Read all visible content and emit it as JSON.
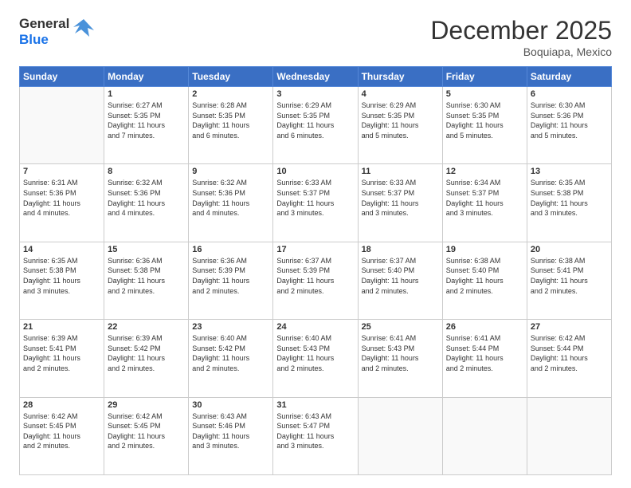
{
  "logo": {
    "line1": "General",
    "line2": "Blue"
  },
  "header": {
    "month": "December 2025",
    "location": "Boquiapa, Mexico"
  },
  "weekdays": [
    "Sunday",
    "Monday",
    "Tuesday",
    "Wednesday",
    "Thursday",
    "Friday",
    "Saturday"
  ],
  "weeks": [
    [
      {
        "day": "",
        "info": ""
      },
      {
        "day": "1",
        "info": "Sunrise: 6:27 AM\nSunset: 5:35 PM\nDaylight: 11 hours\nand 7 minutes."
      },
      {
        "day": "2",
        "info": "Sunrise: 6:28 AM\nSunset: 5:35 PM\nDaylight: 11 hours\nand 6 minutes."
      },
      {
        "day": "3",
        "info": "Sunrise: 6:29 AM\nSunset: 5:35 PM\nDaylight: 11 hours\nand 6 minutes."
      },
      {
        "day": "4",
        "info": "Sunrise: 6:29 AM\nSunset: 5:35 PM\nDaylight: 11 hours\nand 5 minutes."
      },
      {
        "day": "5",
        "info": "Sunrise: 6:30 AM\nSunset: 5:35 PM\nDaylight: 11 hours\nand 5 minutes."
      },
      {
        "day": "6",
        "info": "Sunrise: 6:30 AM\nSunset: 5:36 PM\nDaylight: 11 hours\nand 5 minutes."
      }
    ],
    [
      {
        "day": "7",
        "info": "Sunrise: 6:31 AM\nSunset: 5:36 PM\nDaylight: 11 hours\nand 4 minutes."
      },
      {
        "day": "8",
        "info": "Sunrise: 6:32 AM\nSunset: 5:36 PM\nDaylight: 11 hours\nand 4 minutes."
      },
      {
        "day": "9",
        "info": "Sunrise: 6:32 AM\nSunset: 5:36 PM\nDaylight: 11 hours\nand 4 minutes."
      },
      {
        "day": "10",
        "info": "Sunrise: 6:33 AM\nSunset: 5:37 PM\nDaylight: 11 hours\nand 3 minutes."
      },
      {
        "day": "11",
        "info": "Sunrise: 6:33 AM\nSunset: 5:37 PM\nDaylight: 11 hours\nand 3 minutes."
      },
      {
        "day": "12",
        "info": "Sunrise: 6:34 AM\nSunset: 5:37 PM\nDaylight: 11 hours\nand 3 minutes."
      },
      {
        "day": "13",
        "info": "Sunrise: 6:35 AM\nSunset: 5:38 PM\nDaylight: 11 hours\nand 3 minutes."
      }
    ],
    [
      {
        "day": "14",
        "info": "Sunrise: 6:35 AM\nSunset: 5:38 PM\nDaylight: 11 hours\nand 3 minutes."
      },
      {
        "day": "15",
        "info": "Sunrise: 6:36 AM\nSunset: 5:38 PM\nDaylight: 11 hours\nand 2 minutes."
      },
      {
        "day": "16",
        "info": "Sunrise: 6:36 AM\nSunset: 5:39 PM\nDaylight: 11 hours\nand 2 minutes."
      },
      {
        "day": "17",
        "info": "Sunrise: 6:37 AM\nSunset: 5:39 PM\nDaylight: 11 hours\nand 2 minutes."
      },
      {
        "day": "18",
        "info": "Sunrise: 6:37 AM\nSunset: 5:40 PM\nDaylight: 11 hours\nand 2 minutes."
      },
      {
        "day": "19",
        "info": "Sunrise: 6:38 AM\nSunset: 5:40 PM\nDaylight: 11 hours\nand 2 minutes."
      },
      {
        "day": "20",
        "info": "Sunrise: 6:38 AM\nSunset: 5:41 PM\nDaylight: 11 hours\nand 2 minutes."
      }
    ],
    [
      {
        "day": "21",
        "info": "Sunrise: 6:39 AM\nSunset: 5:41 PM\nDaylight: 11 hours\nand 2 minutes."
      },
      {
        "day": "22",
        "info": "Sunrise: 6:39 AM\nSunset: 5:42 PM\nDaylight: 11 hours\nand 2 minutes."
      },
      {
        "day": "23",
        "info": "Sunrise: 6:40 AM\nSunset: 5:42 PM\nDaylight: 11 hours\nand 2 minutes."
      },
      {
        "day": "24",
        "info": "Sunrise: 6:40 AM\nSunset: 5:43 PM\nDaylight: 11 hours\nand 2 minutes."
      },
      {
        "day": "25",
        "info": "Sunrise: 6:41 AM\nSunset: 5:43 PM\nDaylight: 11 hours\nand 2 minutes."
      },
      {
        "day": "26",
        "info": "Sunrise: 6:41 AM\nSunset: 5:44 PM\nDaylight: 11 hours\nand 2 minutes."
      },
      {
        "day": "27",
        "info": "Sunrise: 6:42 AM\nSunset: 5:44 PM\nDaylight: 11 hours\nand 2 minutes."
      }
    ],
    [
      {
        "day": "28",
        "info": "Sunrise: 6:42 AM\nSunset: 5:45 PM\nDaylight: 11 hours\nand 2 minutes."
      },
      {
        "day": "29",
        "info": "Sunrise: 6:42 AM\nSunset: 5:45 PM\nDaylight: 11 hours\nand 2 minutes."
      },
      {
        "day": "30",
        "info": "Sunrise: 6:43 AM\nSunset: 5:46 PM\nDaylight: 11 hours\nand 3 minutes."
      },
      {
        "day": "31",
        "info": "Sunrise: 6:43 AM\nSunset: 5:47 PM\nDaylight: 11 hours\nand 3 minutes."
      },
      {
        "day": "",
        "info": ""
      },
      {
        "day": "",
        "info": ""
      },
      {
        "day": "",
        "info": ""
      }
    ]
  ]
}
